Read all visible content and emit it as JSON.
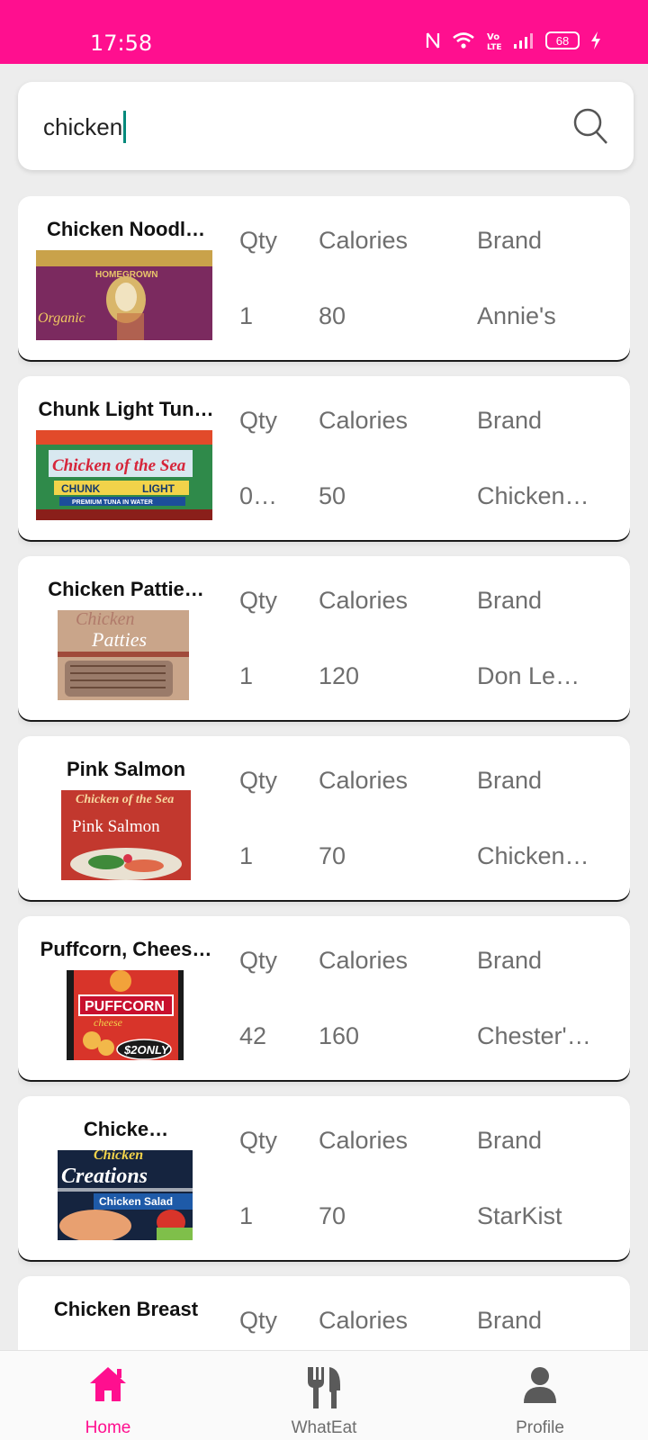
{
  "status_bar": {
    "time": "17:58",
    "battery": "68",
    "color": "#ff0f8f"
  },
  "search": {
    "value": "chicken"
  },
  "columns": {
    "qty": "Qty",
    "calories": "Calories",
    "brand": "Brand"
  },
  "items": [
    {
      "name": "Chicken Noodl…",
      "qty": "1",
      "calories": "80",
      "brand": "Annie's"
    },
    {
      "name": "Chunk Light Tun…",
      "qty": "0…",
      "calories": "50",
      "brand": "Chicken…"
    },
    {
      "name": "Chicken Pattie…",
      "qty": "1",
      "calories": "120",
      "brand": "Don Le…"
    },
    {
      "name": "Pink Salmon",
      "qty": "1",
      "calories": "70",
      "brand": "Chicken…"
    },
    {
      "name": "Puffcorn, Chees…",
      "qty": "42",
      "calories": "160",
      "brand": "Chester'…"
    },
    {
      "name": "Chicke…",
      "qty": "1",
      "calories": "70",
      "brand": "StarKist"
    },
    {
      "name": "Chicken Breast",
      "qty": "",
      "calories": "",
      "brand": ""
    }
  ],
  "thumb_text": {
    "annies": {
      "line1": "HOMEGROWN",
      "line2": "Organic"
    },
    "tuna": {
      "line1": "Chicken of the Sea",
      "line2": "CHUNK",
      "line3": "LIGHT",
      "line4": "PREMIUM TUNA IN WATER"
    },
    "patties": {
      "line1": "Chicken",
      "line2": "Patties"
    },
    "salmon": {
      "line1": "Chicken of the Sea",
      "line2": "Pink Salmon"
    },
    "puffcorn": {
      "line1": "PUFFCORN",
      "line2": "cheese",
      "line3": "$2ONLY"
    },
    "creations": {
      "line1": "Chicken",
      "line2": "Creations",
      "line3": "Chicken Salad"
    }
  },
  "bottom_nav": [
    {
      "label": "Home",
      "icon": "home-icon",
      "active": true
    },
    {
      "label": "WhatEat",
      "icon": "fork-knife-icon",
      "active": false
    },
    {
      "label": "Profile",
      "icon": "person-icon",
      "active": false
    }
  ],
  "colors": {
    "accent": "#ff0f8f",
    "caret": "#00897b",
    "muted_text": "#6e6e6e"
  }
}
